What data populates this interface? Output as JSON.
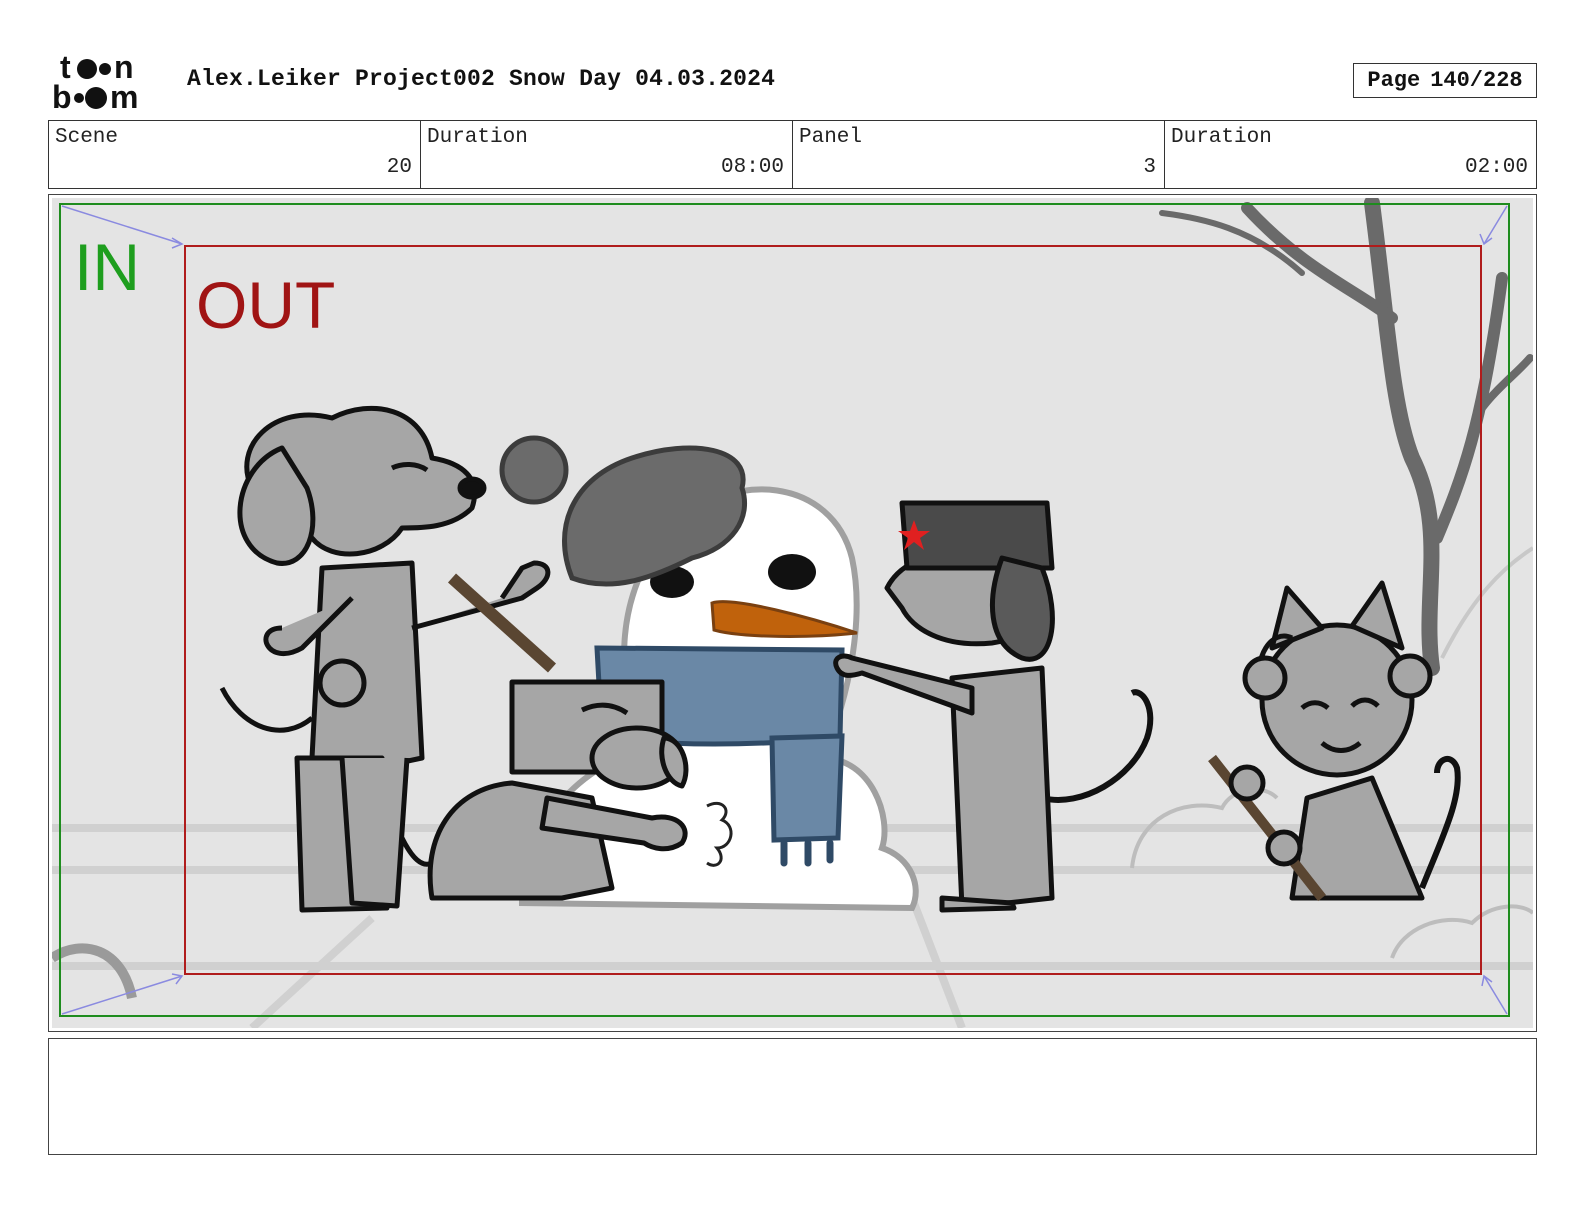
{
  "header": {
    "logo_text": "toonboom",
    "project_title": "Alex.Leiker Project002 Snow Day 04.03.2024",
    "page_label": "Page",
    "page_value": "140/228"
  },
  "info": {
    "scene_label": "Scene",
    "scene_value": "20",
    "scene_duration_label": "Duration",
    "scene_duration_value": "08:00",
    "panel_label": "Panel",
    "panel_value": "3",
    "panel_duration_label": "Duration",
    "panel_duration_value": "02:00"
  },
  "panel": {
    "in_label": "IN",
    "out_label": "OUT",
    "colors": {
      "in_frame": "#1e8c1e",
      "out_frame": "#b01c1c",
      "background": "#e4e4e4",
      "scarf": "#6a88a6",
      "carrot": "#c0620c",
      "hat_star": "#e02020"
    }
  },
  "notes": {
    "text": ""
  }
}
